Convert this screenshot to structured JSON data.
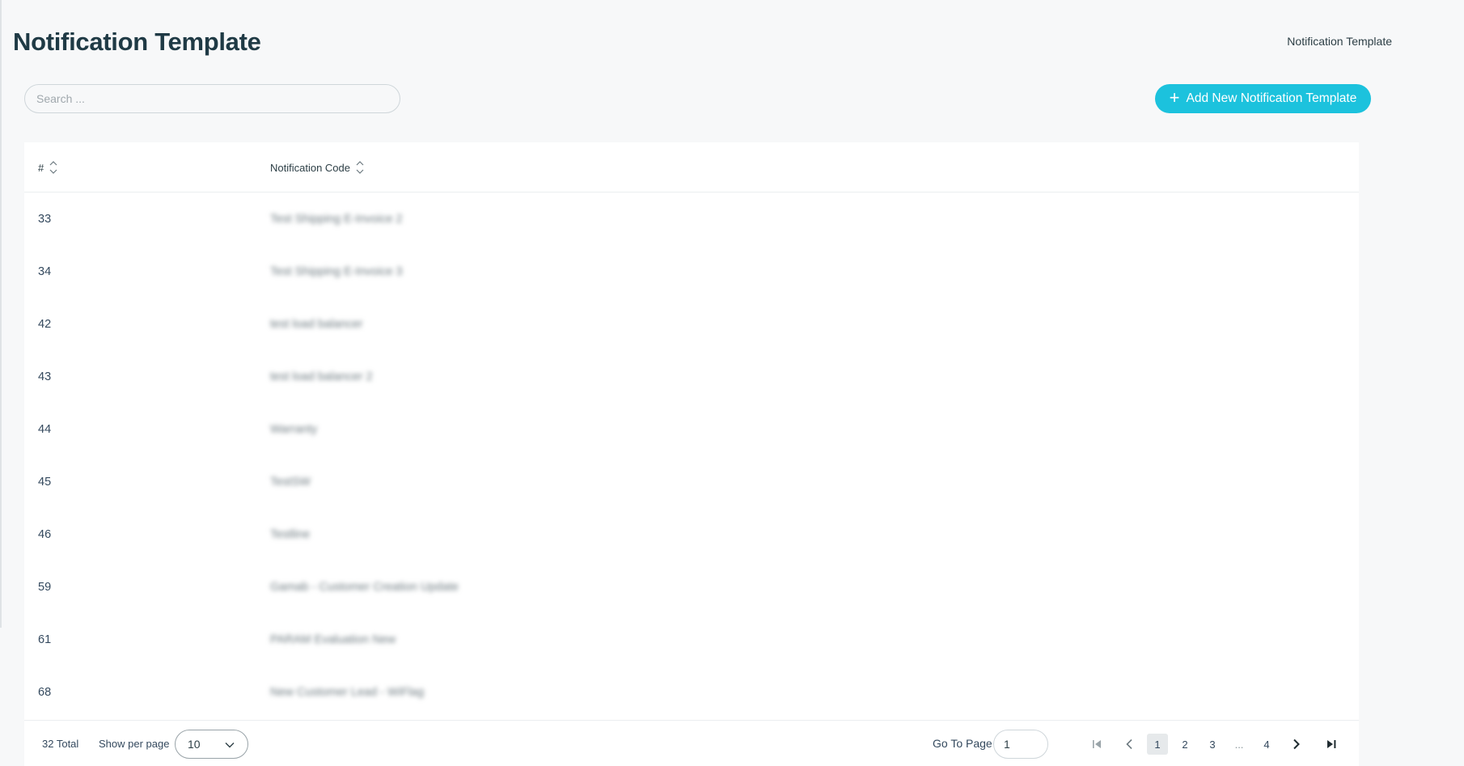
{
  "header": {
    "title": "Notification Template",
    "breadcrumb": "Notification Template"
  },
  "toolbar": {
    "search_placeholder": "Search ...",
    "add_button_label": "Add New Notification Template"
  },
  "table": {
    "columns": [
      "#",
      "Notification Code"
    ],
    "rows": [
      {
        "id": "33",
        "code": "Test Shipping E-Invoice 2"
      },
      {
        "id": "34",
        "code": "Test Shipping E-Invoice 3"
      },
      {
        "id": "42",
        "code": "test load balancer"
      },
      {
        "id": "43",
        "code": "test load balancer 2"
      },
      {
        "id": "44",
        "code": "Warranty"
      },
      {
        "id": "45",
        "code": "TestSW"
      },
      {
        "id": "46",
        "code": "Testline"
      },
      {
        "id": "59",
        "code": "Gamab - Customer Creation Update"
      },
      {
        "id": "61",
        "code": "PARAM Evaluation New"
      },
      {
        "id": "68",
        "code": "New Customer Lead - WiFlag"
      }
    ]
  },
  "pagination": {
    "total_label": "32 Total",
    "per_page_label": "Show per page",
    "per_page_value": "10",
    "goto_label": "Go To Page",
    "goto_value": "1",
    "pages": [
      "1",
      "2",
      "3",
      "...",
      "4"
    ],
    "current_page": "1"
  },
  "colors": {
    "accent": "#1cc2dd",
    "background": "#f7f8f9",
    "card": "#ffffff"
  }
}
